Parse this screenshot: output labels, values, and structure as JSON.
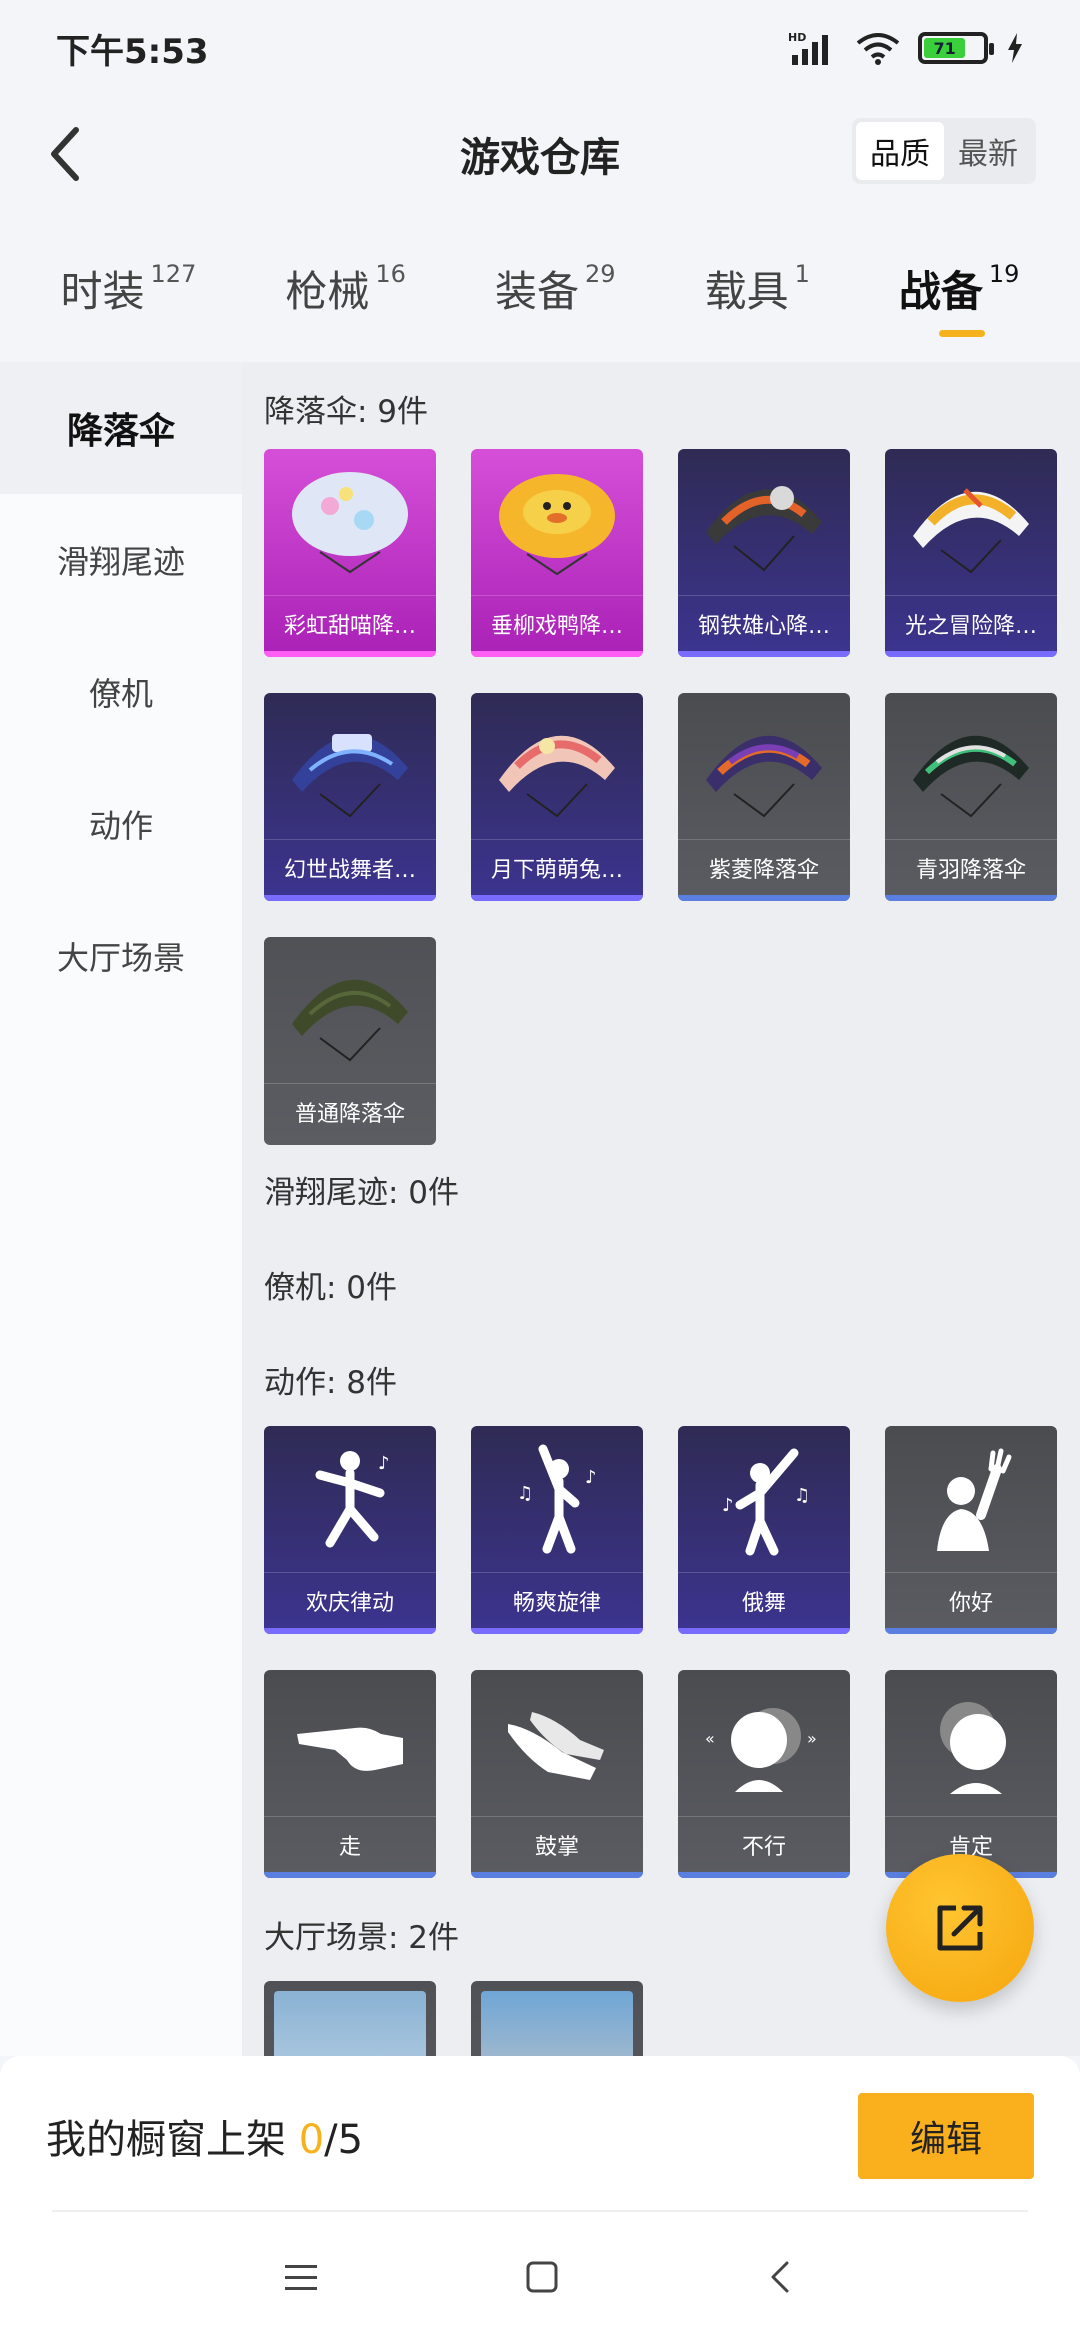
{
  "status_bar": {
    "time": "下午5:53",
    "battery": "71"
  },
  "header": {
    "title": "游戏仓库",
    "sort_options": [
      "品质",
      "最新"
    ]
  },
  "tabs": [
    {
      "label": "时装",
      "count": "127"
    },
    {
      "label": "枪械",
      "count": "16"
    },
    {
      "label": "装备",
      "count": "29"
    },
    {
      "label": "载具",
      "count": "1"
    },
    {
      "label": "战备",
      "count": "19"
    }
  ],
  "sidebar": [
    "降落伞",
    "滑翔尾迹",
    "僚机",
    "动作",
    "大厅场景"
  ],
  "sections": {
    "parachute": {
      "title": "降落伞: 9件",
      "items": [
        "彩虹甜喵降…",
        "垂柳戏鸭降…",
        "钢铁雄心降…",
        "光之冒险降…",
        "幻世战舞者…",
        "月下萌萌兔…",
        "紫菱降落伞",
        "青羽降落伞",
        "普通降落伞"
      ]
    },
    "trail": {
      "title": "滑翔尾迹: 0件"
    },
    "wingman": {
      "title": "僚机: 0件"
    },
    "emote": {
      "title": "动作: 8件",
      "items": [
        "欢庆律动",
        "畅爽旋律",
        "俄舞",
        "你好",
        "走",
        "鼓掌",
        "不行",
        "肯定"
      ]
    },
    "lobby": {
      "title": "大厅场景: 2件"
    }
  },
  "bottom": {
    "label": "我的橱窗上架 ",
    "count": "0",
    "total": "/5",
    "edit_label": "编辑"
  },
  "colors": {
    "accent": "#f6b21c",
    "pink_quality": "#c93ccc",
    "purple_quality": "#3a3390",
    "gray_quality": "#55565b"
  }
}
